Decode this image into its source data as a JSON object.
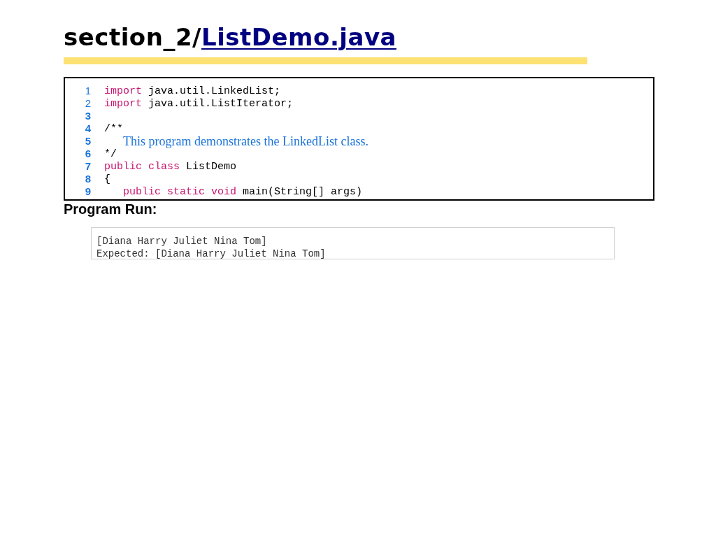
{
  "title": {
    "prefix": "section_2/",
    "link": "ListDemo.java"
  },
  "code": {
    "lines": [
      {
        "number": "1",
        "bold": false,
        "indent": false,
        "tokens": [
          {
            "kind": "keyword",
            "text": "import"
          },
          {
            "kind": "plain",
            "text": " java.util.LinkedList;"
          }
        ]
      },
      {
        "number": "2",
        "bold": false,
        "indent": false,
        "tokens": [
          {
            "kind": "keyword",
            "text": "import"
          },
          {
            "kind": "plain",
            "text": " java.util.ListIterator;"
          }
        ]
      },
      {
        "number": "3",
        "bold": true
      },
      {
        "number": "4",
        "bold": true,
        "indent": false,
        "tokens": [
          {
            "kind": "plain",
            "text": "/**"
          }
        ]
      },
      {
        "number": "5",
        "bold": true,
        "indent": true,
        "tokens": [
          {
            "kind": "comment",
            "text": "This program demonstrates the LinkedList class."
          }
        ]
      },
      {
        "number": "6",
        "bold": true,
        "indent": false,
        "tokens": [
          {
            "kind": "plain",
            "text": "*/"
          }
        ]
      },
      {
        "number": "7",
        "bold": true,
        "indent": false,
        "tokens": [
          {
            "kind": "keyword",
            "text": "public class"
          },
          {
            "kind": "plain",
            "text": " ListDemo"
          }
        ]
      },
      {
        "number": "8",
        "bold": true,
        "indent": false,
        "tokens": [
          {
            "kind": "plain",
            "text": "{"
          }
        ]
      },
      {
        "number": "9",
        "bold": true,
        "indent": true,
        "tokens": [
          {
            "kind": "keyword",
            "text": "public static void"
          },
          {
            "kind": "plain",
            "text": " main(String[] args)"
          }
        ]
      }
    ]
  },
  "program_run": {
    "heading": "Program Run:",
    "output": [
      "[Diana Harry Juliet Nina Tom]",
      "Expected: [Diana Harry Juliet Nina Tom]"
    ]
  }
}
